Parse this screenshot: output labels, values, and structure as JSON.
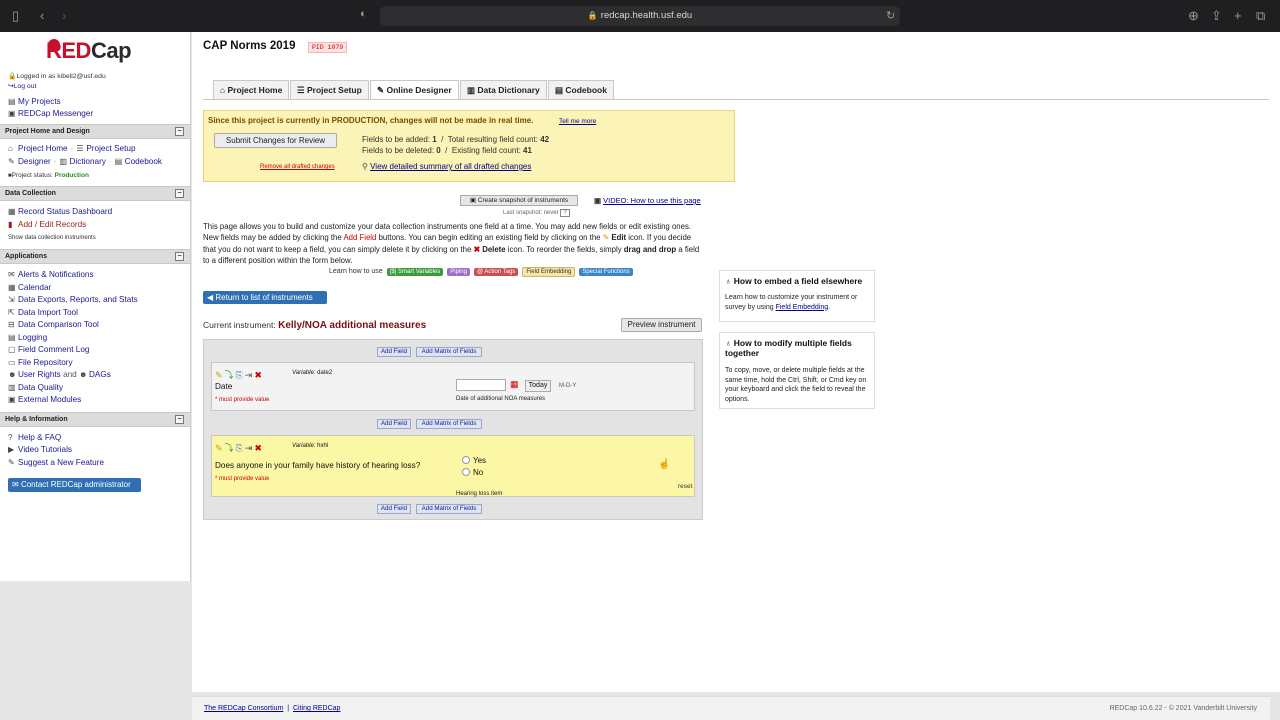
{
  "browser": {
    "url": "redcap.health.usf.edu"
  },
  "sidebar": {
    "logo": {
      "part1": "RED",
      "part2": "Cap"
    },
    "logged_in": "Logged in as kibell2@usf.edu",
    "logout": "Log out",
    "my_projects": "My Projects",
    "messenger": "REDCap Messenger",
    "sections": {
      "project_home": "Project Home and Design",
      "data_collection": "Data Collection",
      "applications": "Applications",
      "help": "Help & Information"
    },
    "project_home": "Project Home",
    "project_setup": "Project Setup",
    "designer": "Designer",
    "dictionary": "Dictionary",
    "codebook": "Codebook",
    "status_label": "Project status:",
    "status_value": "Production",
    "record_status": "Record Status Dashboard",
    "add_edit": "Add / Edit Records",
    "show_instruments": "Show data collection instruments",
    "apps": {
      "alerts": "Alerts & Notifications",
      "calendar": "Calendar",
      "exports": "Data Exports, Reports, and Stats",
      "import": "Data Import Tool",
      "comparison": "Data Comparison Tool",
      "logging": "Logging",
      "comment_log": "Field Comment Log",
      "file_repo": "File Repository",
      "user_rights": "User Rights",
      "and": "and",
      "dags": "DAGs",
      "quality": "Data Quality",
      "modules": "External Modules"
    },
    "help": {
      "faq": "Help & FAQ",
      "videos": "Video Tutorials",
      "suggest": "Suggest a New Feature",
      "contact": "Contact REDCap administrator"
    }
  },
  "header": {
    "title": "CAP Norms 2019",
    "pid": "PID 1079"
  },
  "tabs": [
    "Project Home",
    "Project Setup",
    "Online Designer",
    "Data Dictionary",
    "Codebook"
  ],
  "production": {
    "notice": "Since this project is currently in PRODUCTION, changes will not be made in real time.",
    "tell_more": "Tell me more",
    "submit": "Submit Changes for Review",
    "remove": "Remove all drafted changes",
    "added_label": "Fields to be added:",
    "added_value": "1",
    "total_label": "Total resulting field count:",
    "total_value": "42",
    "deleted_label": "Fields to be deleted:",
    "deleted_value": "0",
    "existing_label": "Existing field count:",
    "existing_value": "41",
    "view_summary": "View detailed summary of all drafted changes"
  },
  "snapshot": {
    "button": "Create snapshot of instruments",
    "last": "Last snapshot: never",
    "help": "?",
    "video": "VIDEO: How to use this page"
  },
  "description": {
    "p1": "This page allows you to build and customize your data collection instruments one field at a time. You may add new fields or edit existing ones. New fields may be added by clicking the",
    "add_field": "Add Field",
    "p2": "buttons. You can begin editing an existing field by clicking on the",
    "edit": "Edit",
    "p3": "icon. If you decide that you do not want to keep a field, you can simply delete it by clicking on the",
    "delete": "Delete",
    "p4": "icon. To reorder the fields, simply",
    "drag": "drag and drop",
    "p5": "a field to a different position within the form below.",
    "learn": "Learn how to use",
    "pills": [
      "[$] Smart Variables",
      "Piping",
      "@ Action Tags",
      "Field Embedding",
      "Special Functions"
    ]
  },
  "instrument": {
    "return": "Return to list of instruments",
    "current_label": "Current instrument:",
    "current_name": "Kelly/NOA additional measures",
    "preview": "Preview instrument",
    "add_field": "Add Field",
    "add_matrix": "Add Matrix of Fields",
    "variable_label": "Variable:",
    "must_provide": "* must provide value",
    "fields": [
      {
        "variable": "date2",
        "label": "Date",
        "today": "Today",
        "format": "M-D-Y",
        "note": "Date of additional NOA measures"
      },
      {
        "variable": "hxhl",
        "label": "Does anyone in your family have history of hearing loss?",
        "choices": [
          "Yes",
          "No"
        ],
        "note": "Hearing loss item",
        "reset": "reset"
      }
    ]
  },
  "help_boxes": [
    {
      "title": "How to embed a field elsewhere",
      "body": "Learn how to customize your instrument or survey by using",
      "link": "Field Embedding",
      "end": "."
    },
    {
      "title": "How to modify multiple fields together",
      "body": "To copy, move, or delete multiple fields at the same time, hold the Ctrl, Shift, or Cmd key on your keyboard and click the field to reveal the options."
    }
  ],
  "footer": {
    "consortium": "The REDCap Consortium",
    "citing": "Citing REDCap",
    "version": "REDCap 10.6.22 - © 2021 Vanderbilt University"
  }
}
